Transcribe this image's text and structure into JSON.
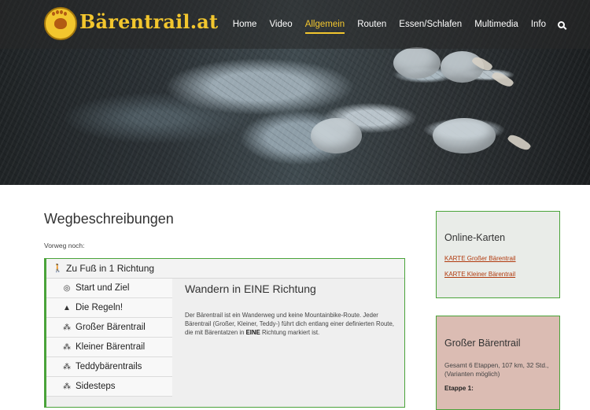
{
  "header": {
    "brand": "Bärentrail.at",
    "nav": [
      "Home",
      "Video",
      "Allgemein",
      "Routen",
      "Essen/Schlafen",
      "Multimedia",
      "Info"
    ],
    "active_nav": "Allgemein",
    "accent_color": "#f2c62e"
  },
  "main": {
    "title": "Wegbeschreibungen",
    "intro": "Vorweg noch:",
    "tab_header": "Zu Fuß in 1 Richtung",
    "tabs": [
      {
        "label": "Start und Ziel",
        "icon": "target-icon"
      },
      {
        "label": "Die Regeln!",
        "icon": "warning-icon"
      },
      {
        "label": "Großer Bärentrail",
        "icon": "paw-icon"
      },
      {
        "label": "Kleiner Bärentrail",
        "icon": "paw-icon"
      },
      {
        "label": "Teddybärentrails",
        "icon": "paw-icon"
      },
      {
        "label": "Sidesteps",
        "icon": "paw-icon"
      }
    ],
    "content": {
      "heading": "Wandern in EINE Richtung",
      "text_before": "Der Bärentrail ist ein Wanderweg und keine Mountainbike-Route. Jeder Bärentrail (Großer, Kleiner, Teddy-) führt dich entlang einer definierten Route, die mit Bärentatzen in ",
      "text_bold": "EINE",
      "text_after": " Richtung markiert ist."
    }
  },
  "sidebar": {
    "card1": {
      "title": "Online-Karten",
      "links": [
        "KARTE Großer Bärentrail",
        "KARTE Kleiner Bärentrail"
      ]
    },
    "card2": {
      "title": "Großer Bärentrail",
      "summary": "Gesamt 6 Etappen, 107 km, 32 Std., (Varianten möglich)",
      "etappe": "Etappe 1:"
    }
  }
}
